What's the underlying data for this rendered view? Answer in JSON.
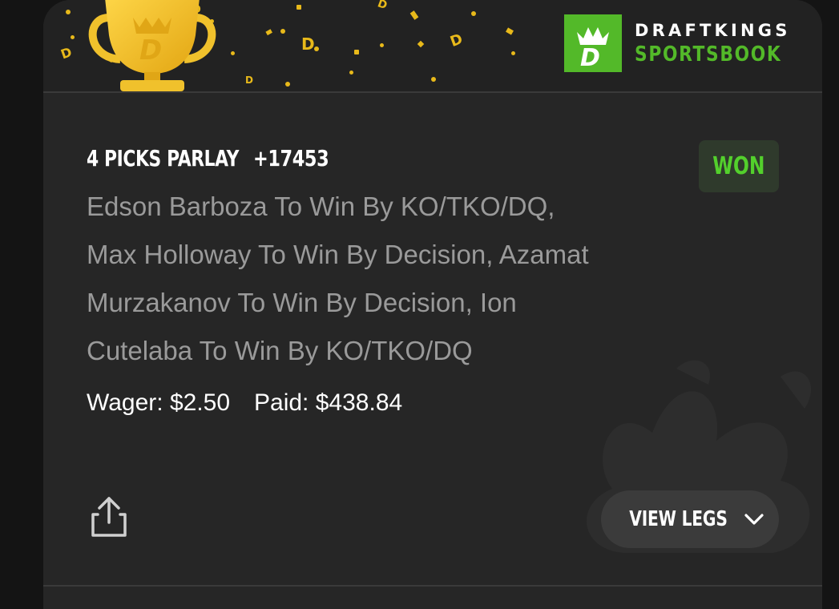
{
  "brand": {
    "line1": "DRAFTKINGS",
    "line2": "SPORTSBOOK",
    "accent_color": "#53b929",
    "logo_icon": "draftkings-crown-d-icon",
    "trophy_icon": "gold-trophy-icon"
  },
  "bet": {
    "type_label": "4 PICKS PARLAY",
    "odds": "+17453",
    "status": "WON",
    "status_color": "#53d02c",
    "legs_line1": "Edson Barboza To Win By KO/TKO/DQ,",
    "legs_line2": "Max Holloway To Win By Decision, Azamat",
    "legs_line3": "Murzakanov To Win By Decision, Ion",
    "legs_line4": "Cutelaba To Win By KO/TKO/DQ",
    "wager_label": "Wager:",
    "wager_value": "$2.50",
    "paid_label": "Paid:",
    "paid_value": "$438.84"
  },
  "actions": {
    "share_icon": "share-icon",
    "view_legs_label": "VIEW LEGS",
    "view_legs_icon": "chevron-down-icon"
  }
}
